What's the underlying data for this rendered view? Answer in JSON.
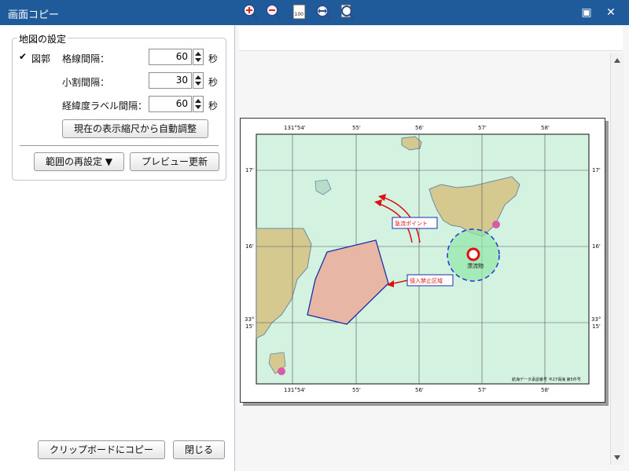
{
  "window": {
    "title": "画面コピー"
  },
  "controls": {
    "maximize": "▣",
    "close": "✕"
  },
  "map_settings": {
    "group_title": "地図の設定",
    "frame_checkbox": {
      "checked": true,
      "label": "図郭"
    },
    "grid_interval": {
      "label": "格線間隔：",
      "value": "60",
      "unit": "秒"
    },
    "sub_interval": {
      "label": "小割間隔：",
      "value": "30",
      "unit": "秒"
    },
    "label_interval": {
      "label": "経緯度ラベル間隔：",
      "value": "60",
      "unit": "秒"
    },
    "auto_adjust_button": "現在の表示縮尺から自動調整"
  },
  "range_button": "範囲の再設定 ▼",
  "preview_button": "プレビュー更新",
  "copy_button": "クリップボードにコピー",
  "close_button": "閉じる",
  "toolbar": {
    "zoom_in": "zoom-in-icon",
    "zoom_out": "zoom-out-icon",
    "actual_size": "actual-size-icon",
    "fit_width": "fit-width-icon",
    "fit_page": "fit-page-icon"
  },
  "map": {
    "top_lon_labels": [
      "131°54'",
      "55'",
      "56'",
      "57'",
      "58'"
    ],
    "bottom_lon_labels": [
      "131°54'",
      "55'",
      "56'",
      "57'",
      "58'"
    ],
    "left_lat_labels": [
      "17'",
      "16'",
      "33°",
      "15'"
    ],
    "right_lat_labels": [
      "17'",
      "16'",
      "33°",
      "15'"
    ],
    "annotations": {
      "current": "急流ポイント",
      "prohibited": "侵入禁止区域",
      "drift": "漂流物"
    },
    "credit": "航海データ承認番号 平27保海 第5件号"
  }
}
